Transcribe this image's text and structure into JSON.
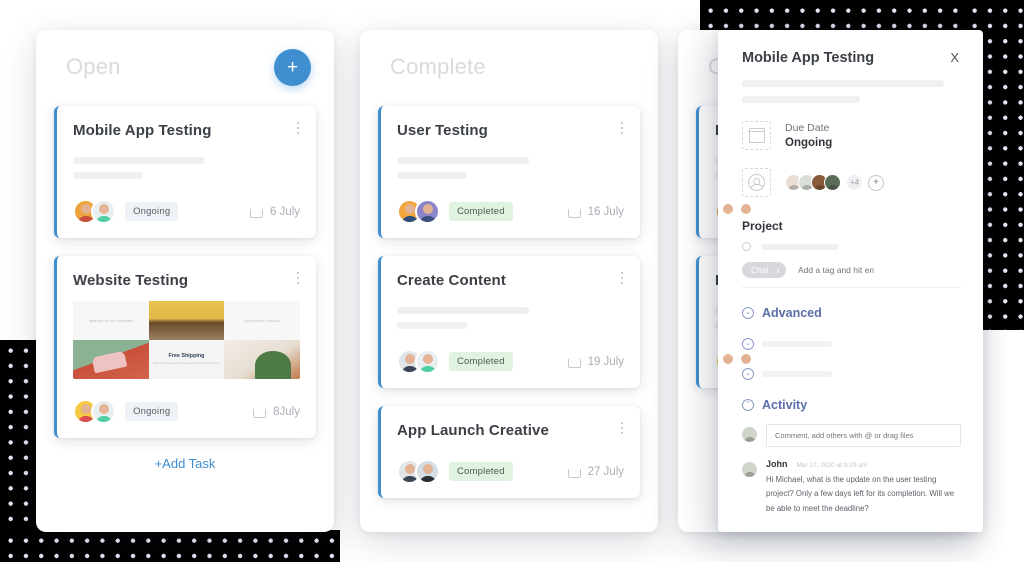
{
  "board": {
    "columns": [
      {
        "key": "open",
        "title": "Open",
        "add_button": "+",
        "add_task_label": "+Add Task",
        "cards": [
          {
            "title": "Mobile App Testing",
            "status": "Ongoing",
            "due": "6 July",
            "has_thumbnail": false
          },
          {
            "title": "Website Testing",
            "status": "Ongoing",
            "due": "8July",
            "has_thumbnail": true,
            "thumbnail": {
              "left_caption": "materials for our customers",
              "right_caption": "our furniture products",
              "promo_title": "Free Shipping",
              "promo_sub": "Free shipping with a free\nacross Furniture here us"
            }
          }
        ]
      },
      {
        "key": "complete",
        "title": "Complete",
        "cards": [
          {
            "title": "User Testing",
            "status": "Completed",
            "due": "16 July"
          },
          {
            "title": "Create Content",
            "status": "Completed",
            "due": "19 July"
          },
          {
            "title": "App Launch Creative",
            "status": "Completed",
            "due": "27 July"
          }
        ]
      },
      {
        "key": "ongoing",
        "title": "Ongoing",
        "cards": [
          {
            "title": "Logo Design",
            "status": "",
            "due": ""
          },
          {
            "title": "Email Design",
            "status": "",
            "due": ""
          }
        ]
      }
    ]
  },
  "detail": {
    "title": "Mobile App Testing",
    "close_label": "X",
    "due_date_label": "Due Date",
    "due_date_value": "Ongoing",
    "assignees_more": "+4",
    "assignees_add": "+",
    "project_label": "Project",
    "tag": "Chat",
    "tag_remove": "x",
    "tag_placeholder": "Add a tag and hit en",
    "advanced_label": "Advanced",
    "activity_label": "Activity",
    "comment_placeholder": "Comment, add others with @ or drag files",
    "comment": {
      "author": "John",
      "time": "Mar 27, 2020 at 9:29 am",
      "text": "Hi Michael, what is the update on the user testing project? Only a few days left for its completion. Will we be able to meet the deadline?"
    }
  },
  "colors": {
    "accent_blue": "#3e8ed0",
    "card_stripe": "#3e8ed0",
    "badge_ongoing_bg": "#eef1f6",
    "badge_completed_bg": "#dff3e0",
    "section_heading": "#5b6ea8",
    "dot_pattern": "#ece4f6",
    "dot_background": "#000000"
  }
}
